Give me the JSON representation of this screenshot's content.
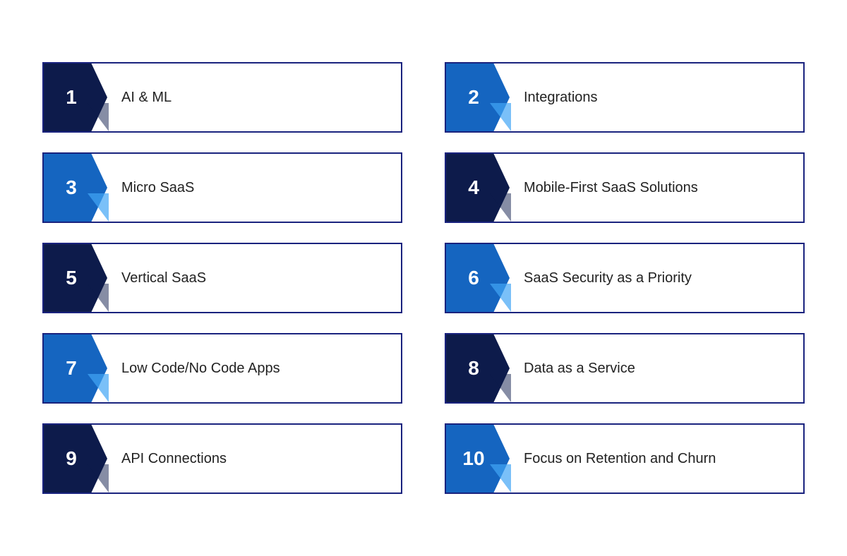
{
  "items": [
    {
      "id": 1,
      "label": "AI & ML",
      "style": "dark"
    },
    {
      "id": 2,
      "label": "Integrations",
      "style": "blue"
    },
    {
      "id": 3,
      "label": "Micro SaaS",
      "style": "blue"
    },
    {
      "id": 4,
      "label": "Mobile-First SaaS Solutions",
      "style": "dark"
    },
    {
      "id": 5,
      "label": "Vertical SaaS",
      "style": "dark"
    },
    {
      "id": 6,
      "label": "SaaS Security as a Priority",
      "style": "blue"
    },
    {
      "id": 7,
      "label": "Low Code/No Code Apps",
      "style": "blue"
    },
    {
      "id": 8,
      "label": "Data as a Service",
      "style": "dark"
    },
    {
      "id": 9,
      "label": "API Connections",
      "style": "dark"
    },
    {
      "id": 10,
      "label": "Focus on Retention and Churn",
      "style": "blue"
    }
  ]
}
